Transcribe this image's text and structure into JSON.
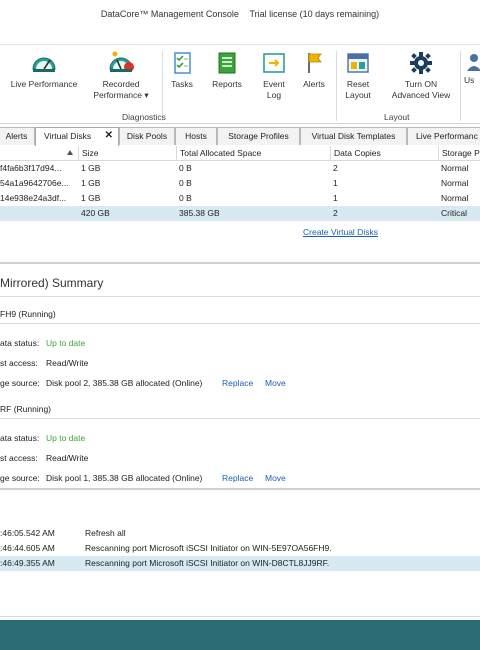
{
  "titlebar": {
    "app": "DataCore™ Management Console",
    "license": "Trial license (10 days remaining)"
  },
  "ribbon": {
    "buttons": [
      {
        "label": "Live Performance",
        "icon": "gauge-icon"
      },
      {
        "label": "Recorded Performance ▾",
        "icon": "gauge-recorded-icon"
      },
      {
        "label": "Tasks",
        "icon": "tasks-icon"
      },
      {
        "label": "Reports",
        "icon": "reports-icon"
      },
      {
        "label": "Event Log",
        "icon": "event-log-icon"
      },
      {
        "label": "Alerts",
        "icon": "flag-icon"
      },
      {
        "label": "Reset Layout",
        "icon": "layout-icon"
      },
      {
        "label": "Turn ON Advanced View",
        "icon": "gear-icon"
      },
      {
        "label": "Us",
        "icon": "users-icon"
      }
    ],
    "groups": {
      "diagnostics": "Diagnostics",
      "layout": "Layout"
    }
  },
  "tabs": [
    "Alerts",
    "Virtual Disks",
    "Disk Pools",
    "Hosts",
    "Storage Profiles",
    "Virtual Disk Templates",
    "Live Performanc"
  ],
  "active_tab": "Virtual Disks",
  "grid": {
    "columns": [
      "Size",
      "Total Allocated Space",
      "Data Copies",
      "Storage P"
    ],
    "rows": [
      {
        "name": "f4fa6b3f17d94...",
        "size": "1 GB",
        "allocated": "0 B",
        "copies": "2",
        "profile": "Normal"
      },
      {
        "name": "54a1a9642706e...",
        "size": "1 GB",
        "allocated": "0 B",
        "copies": "1",
        "profile": "Normal"
      },
      {
        "name": "14e938e24a3df...",
        "size": "1 GB",
        "allocated": "0 B",
        "copies": "1",
        "profile": "Normal"
      },
      {
        "name": "",
        "size": "420 GB",
        "allocated": "385.38 GB",
        "copies": "2",
        "profile": "Critical"
      }
    ],
    "create_link": "Create Virtual Disks"
  },
  "summary": {
    "title": "Mirrored) Summary",
    "sections": [
      {
        "header": "FH9 (Running)",
        "status_label": "ata status:",
        "status_value": "Up to date",
        "access_label": "st access:",
        "access_value": "Read/Write",
        "source_label": "ge source:",
        "source_value": "Disk pool 2, 385.38 GB allocated (Online)",
        "replace": "Replace",
        "move": "Move"
      },
      {
        "header": "RF (Running)",
        "status_label": "ata status:",
        "status_value": "Up to date",
        "access_label": "st access:",
        "access_value": "Read/Write",
        "source_label": "ge source:",
        "source_value": "Disk pool 1, 385.38 GB allocated (Online)",
        "replace": "Replace",
        "move": "Move"
      }
    ]
  },
  "log": [
    {
      "time": ":46:05.542 AM",
      "message": "Refresh all"
    },
    {
      "time": ":46:44.605 AM",
      "message": "Rescanning port Microsoft iSCSI Initiator on WIN-5E97OA56FH9."
    },
    {
      "time": ":46:49.355 AM",
      "message": "Rescanning port Microsoft iSCSI Initiator on WIN-D8CTL8JJ9RF."
    }
  ],
  "colors": {
    "accent": "#2b6c74",
    "selection": "#d7eaf2",
    "link": "#1a5fb4",
    "ok": "#3aa43a"
  }
}
